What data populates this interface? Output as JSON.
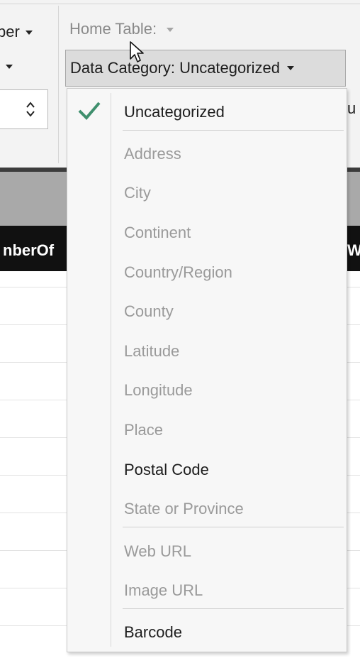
{
  "ribbon": {
    "top_left_fragment": "ber",
    "home_table_label": "Home Table:",
    "data_category_button": "Data Category: Uncategorized",
    "right_fragment": "u"
  },
  "grid": {
    "col1_header": "nberOf",
    "col2_header": "W"
  },
  "menu": {
    "selected": "Uncategorized",
    "items": [
      {
        "label": "Uncategorized",
        "enabled": true,
        "checked": true
      },
      {
        "label": "Address",
        "enabled": false
      },
      {
        "label": "City",
        "enabled": false
      },
      {
        "label": "Continent",
        "enabled": false
      },
      {
        "label": "Country/Region",
        "enabled": false
      },
      {
        "label": "County",
        "enabled": false
      },
      {
        "label": "Latitude",
        "enabled": false
      },
      {
        "label": "Longitude",
        "enabled": false
      },
      {
        "label": "Place",
        "enabled": false
      },
      {
        "label": "Postal Code",
        "enabled": true
      },
      {
        "label": "State or Province",
        "enabled": false
      },
      {
        "label": "Web URL",
        "enabled": false
      },
      {
        "label": "Image URL",
        "enabled": false
      },
      {
        "label": "Barcode",
        "enabled": true
      }
    ]
  },
  "colors": {
    "check_accent": "#3f8f6d",
    "disabled_text": "#9a9a9a",
    "enabled_text": "#1d1d1d"
  }
}
